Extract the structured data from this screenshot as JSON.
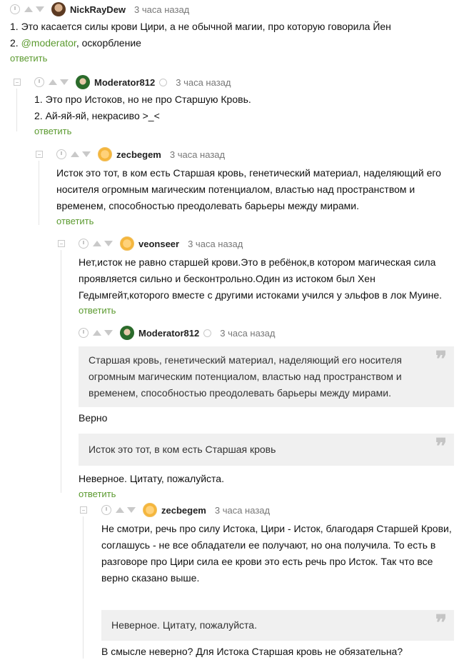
{
  "comments": [
    {
      "author": "NickRayDew",
      "time": "3 часа назад",
      "lines": [
        "1. Это касается силы крови Цири, а не обычной магии, про которую говорила Йен"
      ],
      "line2_mention": "@moderator",
      "line2_prefix": "2. ",
      "line2_rest": ", оскорбление",
      "reply": "ответить"
    },
    {
      "author": "Moderator812",
      "time": "3 часа назад",
      "lines": [
        "1. Это про Истоков, но не про Старшую Кровь.",
        "2. Ай-яй-яй, некрасиво >_<"
      ],
      "reply": "ответить"
    },
    {
      "author": "zecbegem",
      "time": "3 часа назад",
      "lines": [
        "Исток это тот, в ком есть Старшая кровь, генетический материал, наделяющий его носителя огромным магическим потенциалом, властью над пространством и временем, способностью преодолевать барьеры между мирами."
      ],
      "reply": "ответить"
    },
    {
      "author": "veonseer",
      "time": "3 часа назад",
      "lines": [
        "Нет,исток не равно старшей крови.Это в ребёнок,в котором магическая сила проявляется сильно и бесконтрольно.Один из истоком был Хен Гедымгейт,которого вместе с другими истоками учился у эльфов в лок Муине."
      ],
      "reply": "ответить"
    },
    {
      "author": "Moderator812",
      "time": "3 часа назад",
      "quote1": "Старшая кровь, генетический материал, наделяющий его носителя огромным магическим потенциалом, властью над пространством и временем, способностью преодолевать барьеры между мирами.",
      "text1": "Верно",
      "quote2": "Исток это тот, в ком есть Старшая кровь",
      "text2": "Неверное. Цитату, пожалуйста.",
      "reply": "ответить"
    },
    {
      "author": "zecbegem",
      "time": "3 часа назад",
      "lines": [
        "Не смотри, речь про силу Истока, Цири - Исток, благодаря Старшей Крови, соглашусь - не все обладатели ее получают, но она получила. То есть в разговоре про Цири сила ее крови это есть речь про Исток. Так что все верно сказано выше."
      ],
      "quote1": "Неверное. Цитату, пожалуйста.",
      "text1": "В смысле неверно? Для Истока Старшая кровь не обязательна?"
    }
  ],
  "icons": {
    "clock": "clock-icon",
    "upvote": "upvote-icon",
    "downvote": "downvote-icon",
    "collapse": "collapse-icon",
    "quote": "quote-icon",
    "verified": "verified-badge-icon"
  },
  "colors": {
    "accent": "#5b9a2f",
    "quote_bg": "#f0f0f0",
    "meta": "#777777"
  }
}
